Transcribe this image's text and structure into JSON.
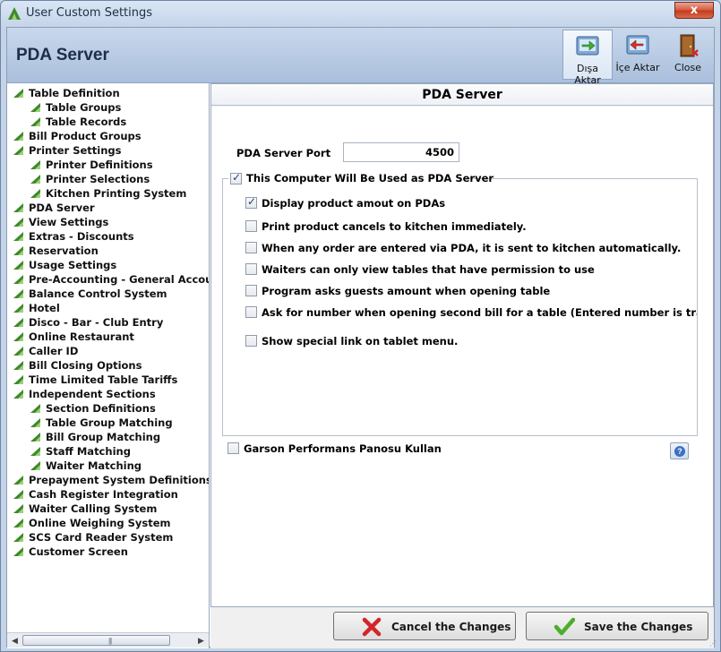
{
  "window": {
    "title": "User Custom Settings",
    "close_glyph": "x"
  },
  "header": {
    "title": "PDA Server",
    "buttons": [
      {
        "label": "Dışa Aktar",
        "icon": "export-icon"
      },
      {
        "label": "İçe Aktar",
        "icon": "import-icon"
      },
      {
        "label": "Close",
        "icon": "door-exit-icon"
      }
    ]
  },
  "tree": {
    "items": [
      {
        "label": "Table Definition",
        "level": 0
      },
      {
        "label": "Table Groups",
        "level": 1
      },
      {
        "label": "Table Records",
        "level": 1
      },
      {
        "label": "Bill Product Groups",
        "level": 0
      },
      {
        "label": "Printer Settings",
        "level": 0
      },
      {
        "label": "Printer Definitions",
        "level": 1
      },
      {
        "label": "Printer Selections",
        "level": 1
      },
      {
        "label": "Kitchen Printing System",
        "level": 1
      },
      {
        "label": "PDA Server",
        "level": 0
      },
      {
        "label": "View Settings",
        "level": 0
      },
      {
        "label": "Extras - Discounts",
        "level": 0
      },
      {
        "label": "Reservation",
        "level": 0
      },
      {
        "label": "Usage Settings",
        "level": 0
      },
      {
        "label": "Pre-Accounting - General Accounting",
        "level": 0
      },
      {
        "label": "Balance Control System",
        "level": 0
      },
      {
        "label": "Hotel",
        "level": 0
      },
      {
        "label": "Disco - Bar - Club Entry",
        "level": 0
      },
      {
        "label": "Online Restaurant",
        "level": 0
      },
      {
        "label": "Caller ID",
        "level": 0
      },
      {
        "label": "Bill Closing Options",
        "level": 0
      },
      {
        "label": "Time Limited Table Tariffs",
        "level": 0
      },
      {
        "label": "Independent Sections",
        "level": 0
      },
      {
        "label": "Section Definitions",
        "level": 1
      },
      {
        "label": "Table Group Matching",
        "level": 1
      },
      {
        "label": "Bill Group Matching",
        "level": 1
      },
      {
        "label": "Staff Matching",
        "level": 1
      },
      {
        "label": "Waiter Matching",
        "level": 1
      },
      {
        "label": "Prepayment System Definitions",
        "level": 0
      },
      {
        "label": "Cash Register Integration",
        "level": 0
      },
      {
        "label": "Waiter Calling System",
        "level": 0
      },
      {
        "label": "Online Weighing System",
        "level": 0
      },
      {
        "label": "SCS Card Reader System",
        "level": 0
      },
      {
        "label": "Customer Screen",
        "level": 0
      }
    ]
  },
  "content": {
    "title": "PDA Server",
    "port_label": "PDA Server Port",
    "port_value": "4500",
    "pda_server_checkbox": {
      "label": "This Computer Will Be Used as PDA Server",
      "checked": true
    },
    "options": [
      {
        "label": "Display product amout on PDAs",
        "checked": true
      },
      {
        "label": "Print product cancels to kitchen immediately.",
        "checked": false
      },
      {
        "label": "When any order are entered via PDA, it is sent to kitchen automatically.",
        "checked": false
      },
      {
        "label": "Waiters can only view tables that have permission to use",
        "checked": false
      },
      {
        "label": "Program asks guests amount when opening table",
        "checked": false
      },
      {
        "label": "Ask for number when opening second bill for a table (Entered number is transferred to bill)",
        "checked": false
      },
      {
        "label": "Show special link on tablet menu.",
        "checked": false
      }
    ],
    "garson_checkbox": {
      "label": "Garson Performans Panosu Kullan",
      "checked": false
    },
    "help_glyph": "?"
  },
  "footer": {
    "cancel_label": "Cancel the Changes",
    "save_label": "Save the Changes"
  },
  "colors": {
    "header_bg": "#aabfdc",
    "tree_icon": "#3f8a2a",
    "cancel_icon": "#d2262a",
    "save_icon": "#4cae2a"
  }
}
